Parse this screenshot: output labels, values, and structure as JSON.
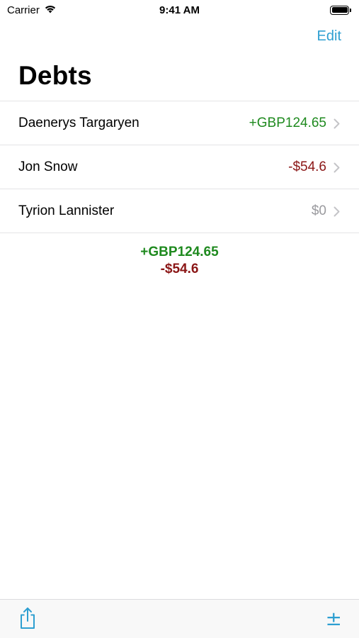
{
  "status_bar": {
    "carrier": "Carrier",
    "time": "9:41 AM"
  },
  "nav": {
    "edit_label": "Edit"
  },
  "page": {
    "title": "Debts"
  },
  "debts": [
    {
      "name": "Daenerys Targaryen",
      "amount": "+GBP124.65",
      "sign": "positive"
    },
    {
      "name": "Jon Snow",
      "amount": "-$54.6",
      "sign": "negative"
    },
    {
      "name": "Tyrion Lannister",
      "amount": "$0",
      "sign": "zero"
    }
  ],
  "totals": [
    {
      "amount": "+GBP124.65",
      "sign": "positive"
    },
    {
      "amount": "-$54.6",
      "sign": "negative"
    }
  ],
  "toolbar": {
    "share_icon": "share-icon",
    "plusminus_glyph": "±"
  },
  "colors": {
    "accent": "#2e9fd1",
    "positive": "#1f8a1f",
    "negative": "#8b1616",
    "zero": "#9a9a9e"
  }
}
